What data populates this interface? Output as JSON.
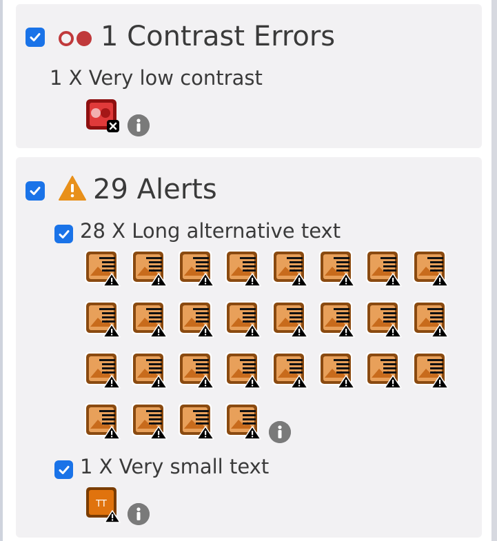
{
  "contrast": {
    "title": "1 Contrast Errors",
    "checked": true,
    "icon": "contrast-error-icon",
    "items": [
      {
        "label": "1 X Very low contrast",
        "count": 1,
        "icon": "very-low-contrast-icon"
      }
    ]
  },
  "alerts": {
    "title": "29 Alerts",
    "checked": true,
    "icon": "warning-triangle-icon",
    "items": [
      {
        "label": "28 X Long alternative text",
        "checked": true,
        "count": 28,
        "icon": "long-alt-text-icon"
      },
      {
        "label": "1 X Very small text",
        "checked": true,
        "count": 1,
        "icon": "very-small-text-icon",
        "icon_text": "TT"
      }
    ]
  },
  "colors": {
    "checkbox": "#1a73e8",
    "error": "#c0393b",
    "warning": "#e8901a",
    "panel": "#f2f1f3",
    "info": "#7a7a7a"
  }
}
